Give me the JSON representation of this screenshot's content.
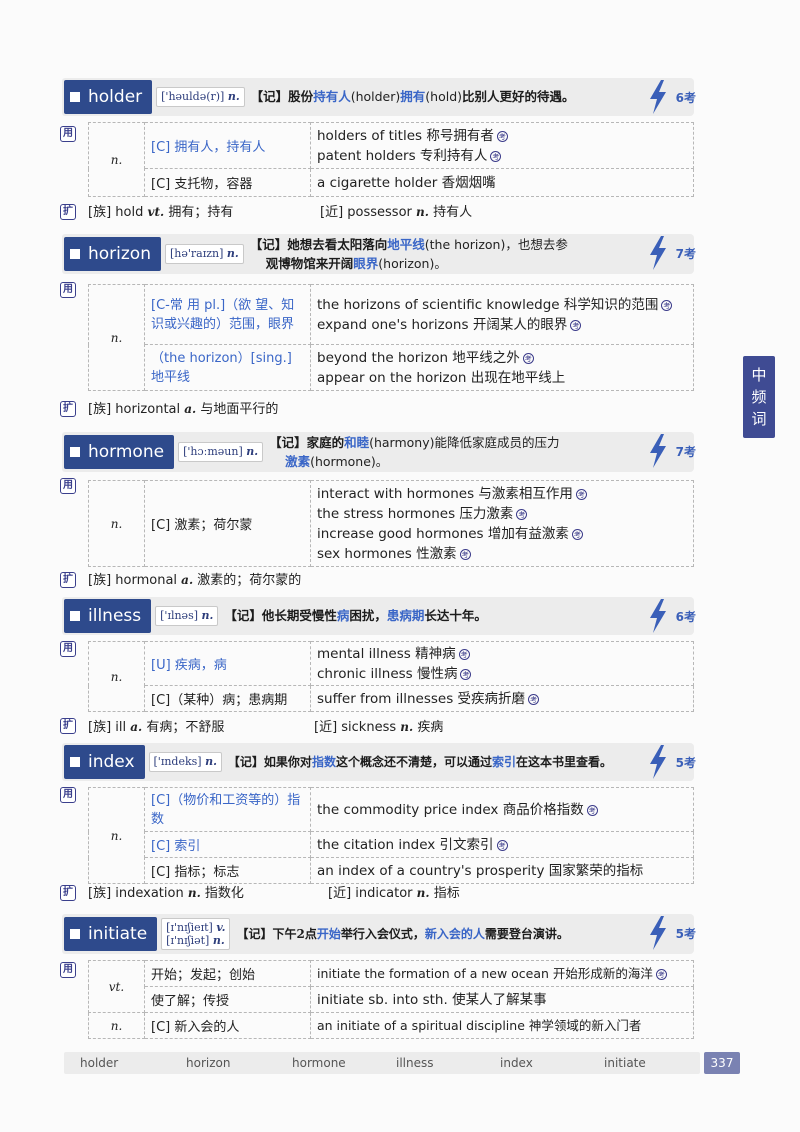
{
  "side_tab": {
    "line1": "中",
    "line2": "频",
    "line3": "词"
  },
  "icons": {
    "use": "用",
    "ext": "扩",
    "kao_mark": "考"
  },
  "entries": {
    "holder": {
      "word": "holder",
      "phonetic": "['həuldə(r)]",
      "pos": "n.",
      "mem_prefix": "【记】股份",
      "mem_hl1": "持有人",
      "mem_paren1": "(holder)",
      "mem_hl2": "拥有",
      "mem_paren2": "(hold)",
      "mem_suffix": "比别人更好的待遇。",
      "exam": "6考",
      "rows": [
        {
          "pos": "n.",
          "meaning": "[C] 拥有人，持有人",
          "examples": [
            "holders of titles 称号拥有者",
            "patent holders 专利持有人"
          ]
        },
        {
          "meaning": "[C] 支托物，容器",
          "examples": [
            "a cigarette holder 香烟烟嘴"
          ]
        }
      ],
      "ext_family": "[族] hold",
      "ext_family_pos": "vt.",
      "ext_family_meaning": "拥有；持有",
      "ext_near": "[近] possessor",
      "ext_near_pos": "n.",
      "ext_near_meaning": "持有人"
    },
    "horizon": {
      "word": "horizon",
      "phonetic": "[hə'raɪzn]",
      "pos": "n.",
      "mem_line1_a": "【记】她想去看太阳落向",
      "mem_line1_hl": "地平线",
      "mem_line1_b": "(the horizon)，也想去参",
      "mem_line2_a": "观博物馆来开阔",
      "mem_line2_hl": "眼界",
      "mem_line2_b": "(horizon)。",
      "exam": "7考",
      "rows": [
        {
          "pos": "n.",
          "meaning": "[C-常 用 pl.]（欲 望、知识或兴趣的）范围，眼界",
          "examples": [
            "the horizons of scientific knowledge 科学知识的范围",
            "expand one's horizons 开阔某人的眼界"
          ]
        },
        {
          "meaning": "（the horizon）[sing.] 地平线",
          "examples": [
            "beyond the horizon 地平线之外",
            "appear on the horizon 出现在地平线上"
          ]
        }
      ],
      "ext_family": "[族] horizontal",
      "ext_family_pos": "a.",
      "ext_family_meaning": "与地面平行的"
    },
    "hormone": {
      "word": "hormone",
      "phonetic": "['hɔːməun]",
      "pos": "n.",
      "mem_line1_a": "【记】家庭的",
      "mem_line1_hl": "和睦",
      "mem_line1_b": "(harmony)能降低家庭成员的压力",
      "mem_line2_hl": "激素",
      "mem_line2_b": "(hormone)。",
      "exam": "7考",
      "rows": [
        {
          "pos": "n.",
          "meaning": "[C] 激素；荷尔蒙",
          "examples": [
            "interact with hormones 与激素相互作用",
            "the stress hormones 压力激素",
            "increase good hormones 增加有益激素",
            "sex hormones 性激素"
          ]
        }
      ],
      "ext_family": "[族] hormonal",
      "ext_family_pos": "a.",
      "ext_family_meaning": "激素的；荷尔蒙的"
    },
    "illness": {
      "word": "illness",
      "phonetic": "['ɪlnəs]",
      "pos": "n.",
      "mem_prefix": "【记】他长期受慢性",
      "mem_hl1": "病",
      "mem_mid": "困扰，",
      "mem_hl2": "患病期",
      "mem_suffix": "长达十年。",
      "exam": "6考",
      "rows": [
        {
          "pos": "n.",
          "meaning": "[U] 疾病，病",
          "examples": [
            "mental illness 精神病",
            "chronic illness 慢性病"
          ]
        },
        {
          "meaning": "[C]（某种）病；患病期",
          "examples": [
            "suffer from illnesses 受疾病折磨"
          ]
        }
      ],
      "ext_family": "[族] ill",
      "ext_family_pos": "a.",
      "ext_family_meaning": "有病；不舒服",
      "ext_near": "[近] sickness",
      "ext_near_pos": "n.",
      "ext_near_meaning": "疾病"
    },
    "index": {
      "word": "index",
      "phonetic": "['ɪndeks]",
      "pos": "n.",
      "mem_prefix": "【记】如果你对",
      "mem_hl1": "指数",
      "mem_mid": "这个概念还不清楚，可以通过",
      "mem_hl2": "索引",
      "mem_suffix": "在这本书里查看。",
      "exam": "5考",
      "rows": [
        {
          "pos": "n.",
          "meaning": "[C]（物价和工资等的）指数",
          "examples": [
            "the commodity price index 商品价格指数"
          ]
        },
        {
          "meaning": "[C] 索引",
          "examples": [
            "the citation index 引文索引"
          ]
        },
        {
          "meaning": "[C] 指标；标志",
          "examples": [
            "an index of a country's prosperity 国家繁荣的指标"
          ]
        }
      ],
      "ext_family": "[族] indexation",
      "ext_family_pos": "n.",
      "ext_family_meaning": "指数化",
      "ext_near": "[近] indicator",
      "ext_near_pos": "n.",
      "ext_near_meaning": "指标"
    },
    "initiate": {
      "word": "initiate",
      "phonetic1": "[ɪ'nɪʃieɪt]",
      "pos1": "v.",
      "phonetic2": "[ɪ'nɪʃiət]",
      "pos2": "n.",
      "mem_prefix": "【记】下午2点",
      "mem_hl1": "开始",
      "mem_mid": "举行入会仪式，",
      "mem_hl2": "新入会的人",
      "mem_suffix": "需要登台演讲。",
      "exam": "5考",
      "rows": [
        {
          "pos": "vt.",
          "meaning": "开始；发起；创始",
          "examples": [
            "initiate the formation of a new ocean 开始形成新的海洋"
          ]
        },
        {
          "meaning": "使了解；传授",
          "examples": [
            "initiate sb. into sth. 使某人了解某事"
          ]
        },
        {
          "pos": "n.",
          "meaning": "[C] 新入会的人",
          "examples": [
            "an initiate of a spiritual discipline 神学领域的新入门者"
          ]
        }
      ]
    }
  },
  "footer": {
    "w1": "holder",
    "w2": "horizon",
    "w3": "hormone",
    "w4": "illness",
    "w5": "index",
    "w6": "initiate",
    "page": "337"
  }
}
